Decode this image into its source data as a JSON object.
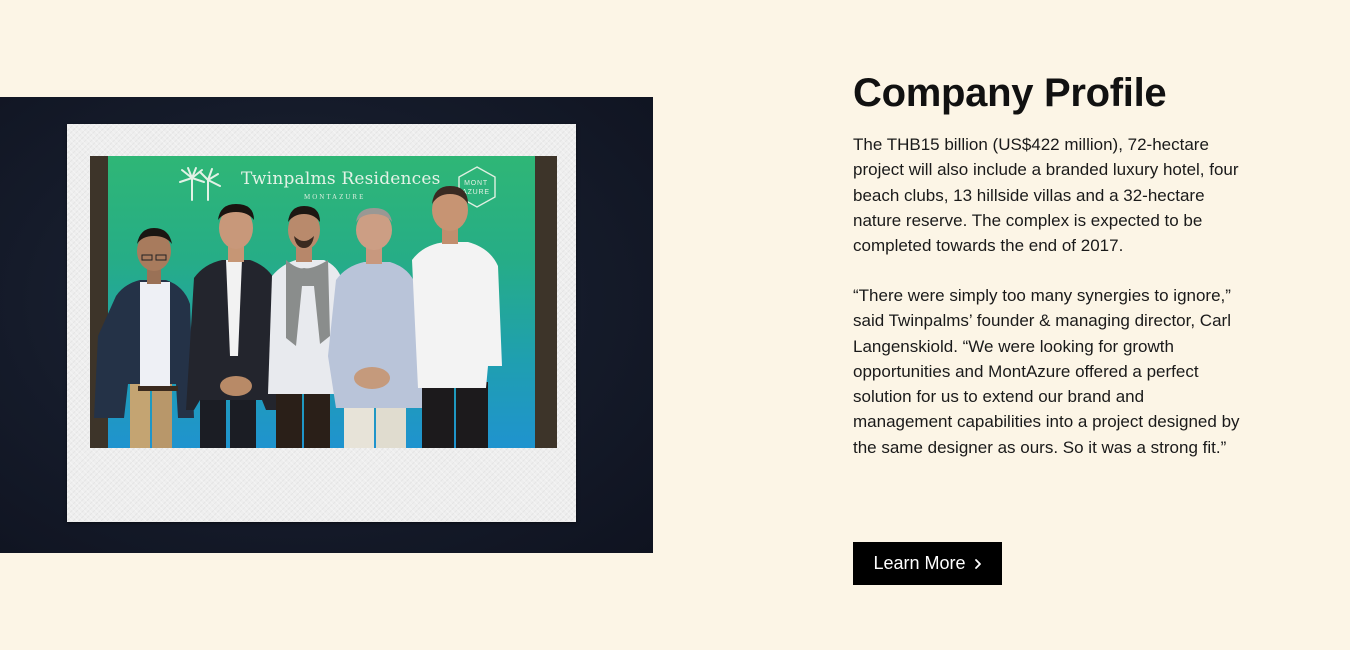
{
  "photo": {
    "alt": "Five men posing in front of a Twinpalms Residences Montazure backdrop",
    "backdrop_title": "Twinpalms Residences",
    "backdrop_subtitle": "MONTAZURE",
    "badge_line1": "MONT",
    "badge_line2": "AZURE"
  },
  "profile": {
    "heading": "Company Profile",
    "paragraph_1": "The THB15 billion (US$422 million), 72-hectare project will also include a branded luxury hotel, four beach clubs, 13 hillside villas and a 32-hectare nature reserve. The complex is expected to be completed towards the end of 2017.",
    "paragraph_2": "“There were simply too many synergies to ignore,” said Twinpalms’ founder & managing director, Carl Langenskiold. “We were looking for growth opportunities and MontAzure offered a perfect solution for us to extend our brand and management capabilities into a project designed by the same designer as ours. So it was a strong fit.”",
    "cta_label": "Learn More",
    "cta_icon": "chevron-right-icon"
  },
  "colors": {
    "page_background": "#fcf5e6",
    "photo_background": "#151b2a",
    "button_background": "#000000",
    "button_text": "#ffffff"
  }
}
